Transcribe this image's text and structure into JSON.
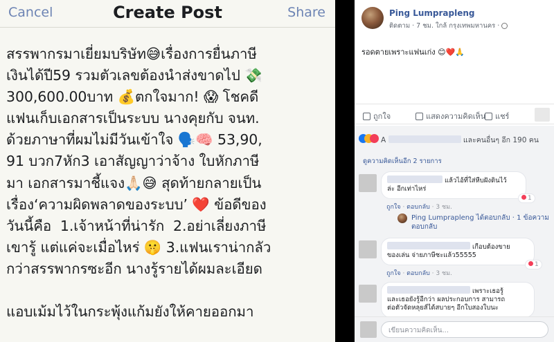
{
  "compose": {
    "cancel_label": "Cancel",
    "title": "Create Post",
    "share_label": "Share",
    "post_lines": [
      "สรรพากรมาเยี่ยมบริษัท😅เรื่องการยื่นภาษี",
      "เงินได้ปี59 รวมตัวเลขต้องนำส่งขาดไป 💸",
      "300,600.00บาท 💰ตกใจมาก! 😱 โชคดี",
      "แฟนเก็บเอกสารเป็นระบบ นางคุยกับ จนท.",
      "ด้วยภาษาที่ผมไม่มีวันเข้าใจ 🗣️🧠 53,90,",
      "91 บวก7หัก3 เอาสัญญาว่าจ้าง ใบหักภาษี",
      "มา เอกสารมาชี้แจง🙏🏻😅 สุดท้ายกลายเป็น",
      "เรื่อง‘ความผิดพลาดของระบบ’ ❤️ ข้อดีของ",
      "วันนี้คือ  1.เจ้าหน้าที่น่ารัก  2.อย่าเลี่ยงภาษี",
      "เขารู้ แต่แค่จะเมื่อไหร่ 🤫 3.แฟนเราน่ากลัว",
      "กว่าสรรพากรซะอีก นางรู้รายได้ผมละเอียด",
      "",
      "แอบเม้มไว้ในกระพุ้งแก้มยังให้คายออกมา"
    ]
  },
  "post": {
    "author": "Ping Lumprapleng",
    "meta": "ติดตาม · 7 ชม. ใกล้ กรุงเทพมหานคร ·",
    "text": "รอดตายเพราะแฟนเก่ง 😊❤️🙏",
    "actions": {
      "like": "ถูกใจ",
      "comment": "แสดงความคิดเห็น",
      "share": "แชร์"
    },
    "reactions_summary": "และคนอื่นๆ อีก 190 คน",
    "reactions_prefix": "A",
    "more_comments": "ดูความคิดเห็นอีก 2 รายการ",
    "comments": [
      {
        "line1": "แล้วไอ้ที่ใส่หีบฝังดินไว้",
        "line2": "ล่ะ อีกเท่าไหร่",
        "like": "ถูกใจ",
        "reply": "ตอบกลับ",
        "time": "3 ชม.",
        "reaction_count": "1",
        "reply_summary": "Ping Lumprapleng ได้ตอบกลับ · 1 ข้อความตอบกลับ"
      },
      {
        "line1": "เกือบต้องขาย",
        "line2": "ของเล่น จ่ายภาษีชะแล้ว55555",
        "like": "ถูกใจ",
        "reply": "ตอบกลับ",
        "time": "3 ชม.",
        "reaction_count": "1"
      },
      {
        "line1": "เพราะเธอรู้",
        "line2": "และเธอยังรู้อีกว่า ผลประกอบการ สามารถ",
        "line3": "ต่อตัวจัดหลุยส์ได้สบายๆ อีกใบสองใบนะ"
      }
    ],
    "write_placeholder": "เขียนความคิดเห็น..."
  },
  "colors": {
    "link": "#385898",
    "ios_blue": "#6d84b4"
  }
}
